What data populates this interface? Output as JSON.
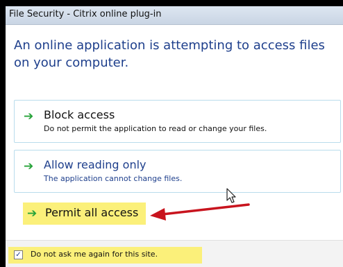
{
  "window": {
    "title": "File Security - Citrix online plug-in"
  },
  "main_instruction": "An online application is attempting to access files on your computer.",
  "options": [
    {
      "icon": "green-arrow-icon",
      "label": "Block access",
      "description": "Do not permit the application to read or change your files."
    },
    {
      "icon": "green-arrow-icon",
      "label": "Allow reading only",
      "description": "The application cannot change files."
    },
    {
      "icon": "green-arrow-icon",
      "label": "Permit all access"
    }
  ],
  "footer": {
    "checkbox_checked": true,
    "checkbox_label": "Do not ask me again for this site."
  },
  "colors": {
    "highlight": "#fbf07a",
    "instruction_text": "#1e3f8c",
    "command_arrow": "#27a33a",
    "annotation_arrow": "#c8141e"
  }
}
